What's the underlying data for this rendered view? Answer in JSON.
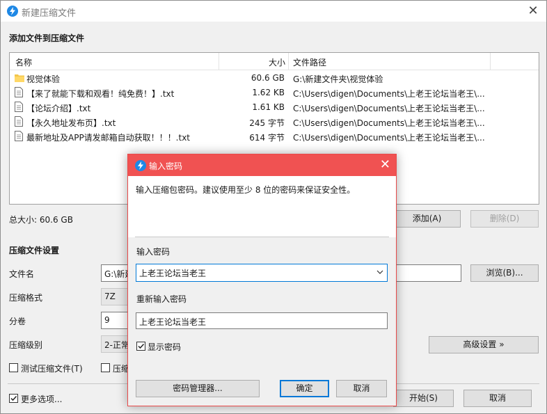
{
  "window": {
    "title": "新建压缩文件",
    "section_add": "添加文件到压缩文件",
    "columns": {
      "name": "名称",
      "size": "大小",
      "path": "文件路径"
    },
    "files": [
      {
        "icon": "folder-icon",
        "name": "视觉体验",
        "size": "60.6 GB",
        "path": "G:\\新建文件夹\\视觉体验"
      },
      {
        "icon": "file-icon",
        "name": "【来了就能下载和观看！纯免费！】.txt",
        "size": "1.62 KB",
        "path": "C:\\Users\\digen\\Documents\\上老王论坛当老王\\..."
      },
      {
        "icon": "file-icon",
        "name": "【论坛介绍】.txt",
        "size": "1.61 KB",
        "path": "C:\\Users\\digen\\Documents\\上老王论坛当老王\\..."
      },
      {
        "icon": "file-icon",
        "name": "【永久地址发布页】.txt",
        "size": "245 字节",
        "path": "C:\\Users\\digen\\Documents\\上老王论坛当老王\\..."
      },
      {
        "icon": "file-icon",
        "name": "最新地址及APP请发邮箱自动获取！！！.txt",
        "size": "614 字节",
        "path": "C:\\Users\\digen\\Documents\\上老王论坛当老王\\..."
      }
    ],
    "total_size": "总大小: 60.6 GB",
    "add_button": "添加(A)",
    "delete_button": "删除(D)",
    "settings_heading": "压缩文件设置",
    "filename_label": "文件名",
    "filename_value": "G:\\新建",
    "browse_button": "浏览(B)...",
    "format_label": "压缩格式",
    "format_value": "7Z",
    "volume_label": "分卷",
    "volume_value": "9",
    "level_label": "压缩级别",
    "level_value": "2-正常",
    "advanced_button": "高级设置 »",
    "test_checkbox": "测试压缩文件(T)",
    "second_checkbox": "压缩",
    "more_options": "更多选项...",
    "start_button": "开始(S)",
    "cancel_button": "取消"
  },
  "dialog": {
    "title": "输入密码",
    "description": "输入压缩包密码。建议使用至少 8 位的密码来保证安全性。",
    "password_label": "输入密码",
    "password_value": "上老王论坛当老王",
    "repeat_label": "重新输入密码",
    "repeat_value": "上老王论坛当老王",
    "show_password": "显示密码",
    "manager_button": "密码管理器...",
    "ok_button": "确定",
    "cancel_button": "取消"
  },
  "colors": {
    "dialog_title_bg": "#f05252",
    "accent": "#0078d7",
    "app_icon": "#1e88e5"
  }
}
